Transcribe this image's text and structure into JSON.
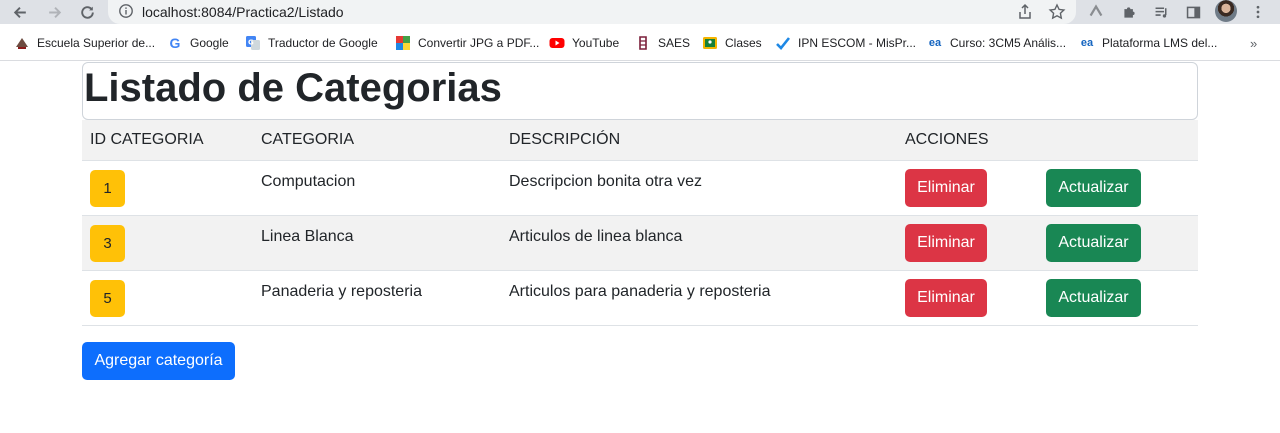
{
  "browser": {
    "url": "localhost:8084/Practica2/Listado",
    "bookmarks": [
      {
        "label": "Escuela Superior de...",
        "icon": "school-favicon",
        "color": "#8b1a1a"
      },
      {
        "label": "Google",
        "icon": "google-favicon",
        "color": "#4285f4"
      },
      {
        "label": "Traductor de Google",
        "icon": "translate-favicon",
        "color": "#4285f4"
      },
      {
        "label": "Convertir JPG a PDF...",
        "icon": "jpg2pdf-favicon",
        "color": "#e53935"
      },
      {
        "label": "YouTube",
        "icon": "youtube-favicon",
        "color": "#ff0000"
      },
      {
        "label": "SAES",
        "icon": "ipn-favicon",
        "color": "#7b1f3a"
      },
      {
        "label": "Clases",
        "icon": "classroom-favicon",
        "color": "#f4b400"
      },
      {
        "label": "IPN ESCOM - MisPr...",
        "icon": "check-favicon",
        "color": "#1e88e5"
      },
      {
        "label": "Curso: 3CM5 Anális...",
        "icon": "ea-favicon",
        "color": "#1565c0"
      },
      {
        "label": "Plataforma LMS del...",
        "icon": "ea-favicon",
        "color": "#1565c0"
      }
    ],
    "more_label": "»"
  },
  "page": {
    "title": "Listado de Categorias",
    "columns": [
      "ID CATEGORIA",
      "CATEGORIA",
      "DESCRIPCIÓN",
      "ACCIONES"
    ],
    "rows": [
      {
        "id": "1",
        "categoria": "Computacion",
        "descripcion": "Descripcion bonita otra vez"
      },
      {
        "id": "3",
        "categoria": "Linea Blanca",
        "descripcion": "Articulos de linea blanca"
      },
      {
        "id": "5",
        "categoria": "Panaderia y reposteria",
        "descripcion": "Articulos para panaderia y reposteria"
      }
    ],
    "delete_label": "Eliminar",
    "update_label": "Actualizar",
    "add_label": "Agregar categoría"
  },
  "colors": {
    "badge": "#ffc107",
    "delete": "#dc3545",
    "update": "#198754",
    "add": "#0d6efd"
  }
}
